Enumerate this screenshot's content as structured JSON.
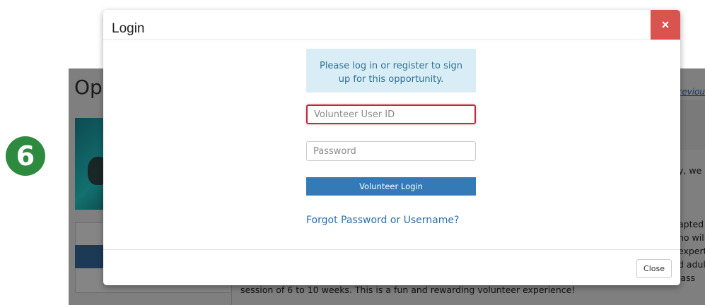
{
  "background": {
    "heading": "Op",
    "prev_link": "Previou",
    "right_text_lines": [
      "y, we",
      "apted",
      "ho will",
      "expert",
      "d adul",
      "lass"
    ],
    "bottom_text": "session of 6 to 10 weeks. This is a fun and rewarding volunteer experience!"
  },
  "step_badge": "6",
  "modal": {
    "title": "Login",
    "close_x": "×",
    "info_message": "Please log in or register to sign up for this opportunity.",
    "userid_placeholder": "Volunteer User ID",
    "userid_value": "",
    "password_placeholder": "Password",
    "password_value": "",
    "login_button": "Volunteer Login",
    "forgot_link": "Forgot Password or Username?",
    "close_button": "Close"
  },
  "colors": {
    "close_x_bg": "#d9534f",
    "info_bg": "#d9edf7",
    "login_button_bg": "#337ab7",
    "focus_border": "#c0283f",
    "badge_bg": "#2e8a3e"
  }
}
